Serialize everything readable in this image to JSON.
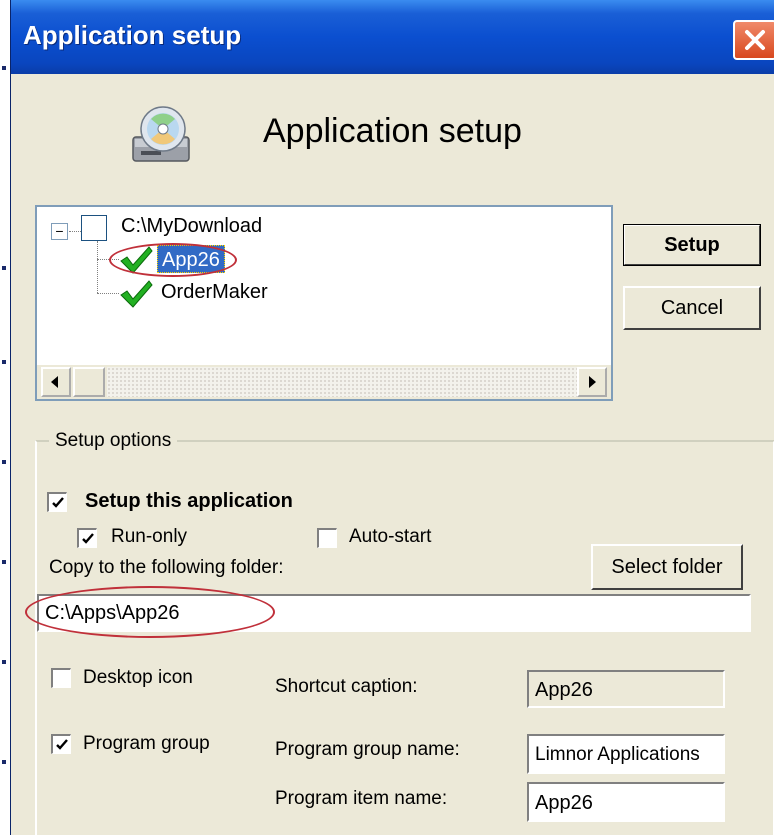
{
  "window": {
    "title": "Application setup"
  },
  "header": {
    "title": "Application setup",
    "icon": "cd-install-icon"
  },
  "tree": {
    "root_label": "C:\\MyDownload",
    "items": [
      {
        "label": "App26",
        "checked": true,
        "selected": true
      },
      {
        "label": "OrderMaker",
        "checked": true,
        "selected": false
      }
    ]
  },
  "buttons": {
    "setup": "Setup",
    "cancel": "Cancel",
    "select_folder": "Select folder"
  },
  "options": {
    "group_title": "Setup options",
    "setup_this_app": {
      "label": "Setup this application",
      "checked": true
    },
    "run_only": {
      "label": "Run-only",
      "checked": true
    },
    "auto_start": {
      "label": "Auto-start",
      "checked": false
    },
    "copy_label": "Copy to the following folder:",
    "folder_value": "C:\\Apps\\App26",
    "desktop_icon": {
      "label": "Desktop icon",
      "checked": false
    },
    "program_group": {
      "label": "Program group",
      "checked": true
    },
    "shortcut_caption": {
      "label": "Shortcut caption:",
      "value": "App26"
    },
    "program_group_name": {
      "label": "Program group name:",
      "value": "Limnor Applications"
    },
    "program_item_name": {
      "label": "Program item name:",
      "value": "App26"
    }
  },
  "colors": {
    "titlebar": "#0b4fd0",
    "selection": "#316ac5",
    "annotation": "#c0303a"
  }
}
